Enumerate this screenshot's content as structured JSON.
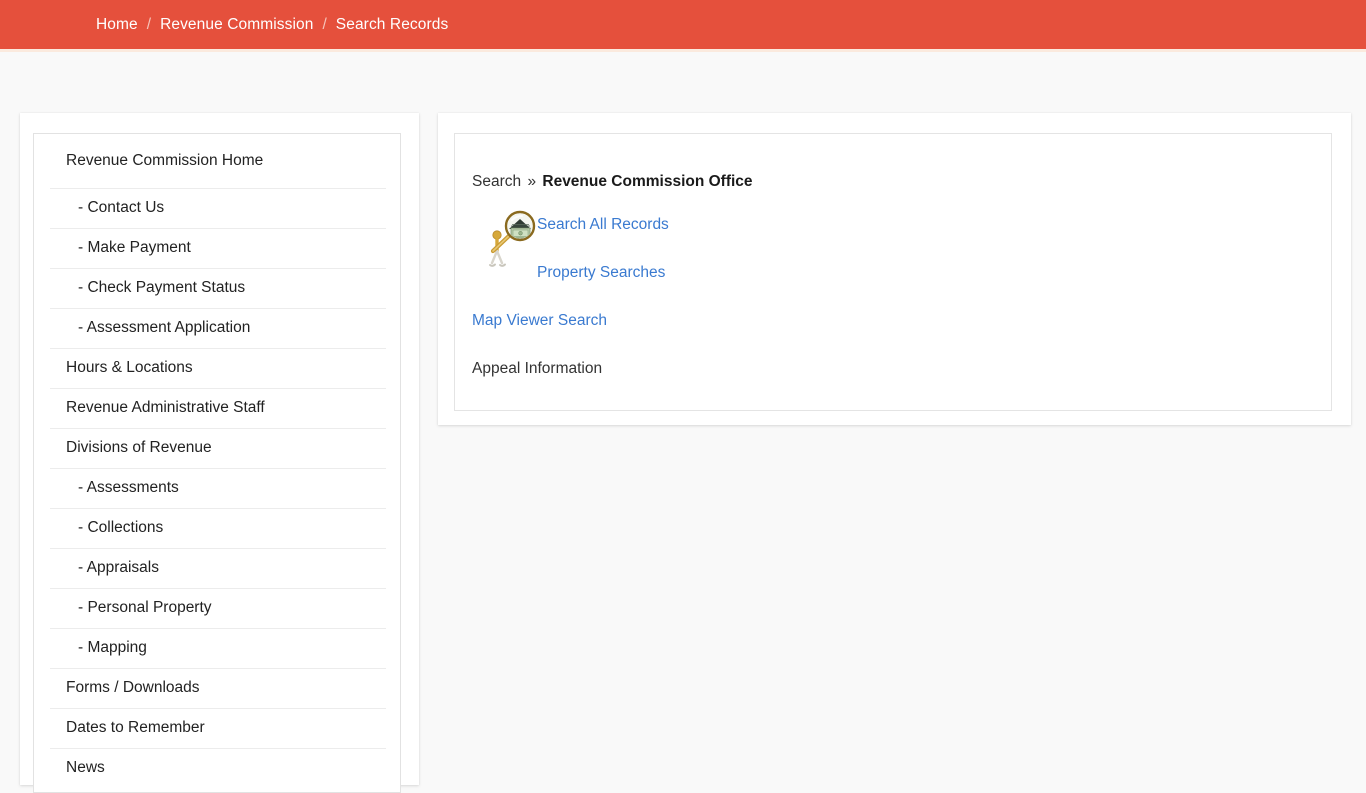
{
  "page": {
    "background_color": "#f9f9f9",
    "title": "Search Records"
  },
  "header": {
    "background_color": "#e5503c",
    "separator": "/",
    "breadcrumbs": [
      {
        "label": "Home"
      },
      {
        "label": "Revenue Commission"
      },
      {
        "label": "Search Records"
      }
    ]
  },
  "sidebar": {
    "items": [
      {
        "label": "Revenue Commission Home",
        "sub": false
      },
      {
        "label": "- Contact Us",
        "sub": true
      },
      {
        "label": "- Make Payment",
        "sub": true
      },
      {
        "label": "- Check Payment Status",
        "sub": true
      },
      {
        "label": "- Assessment Application",
        "sub": true
      },
      {
        "label": "Hours & Locations",
        "sub": false
      },
      {
        "label": "Revenue Administrative Staff",
        "sub": false
      },
      {
        "label": "Divisions of Revenue",
        "sub": false
      },
      {
        "label": "- Assessments",
        "sub": true
      },
      {
        "label": "- Collections",
        "sub": true
      },
      {
        "label": "- Appraisals",
        "sub": true
      },
      {
        "label": "- Personal Property",
        "sub": true
      },
      {
        "label": "- Mapping",
        "sub": true
      },
      {
        "label": "Forms / Downloads",
        "sub": false
      },
      {
        "label": "Dates to Remember",
        "sub": false
      },
      {
        "label": "News",
        "sub": false
      }
    ]
  },
  "main": {
    "heading": {
      "prefix": "Search",
      "chevron": "»",
      "office": "Revenue Commission Office"
    },
    "icon_name": "magnifying-glass-money-clipart",
    "links": [
      {
        "label": "Search All Records",
        "color": "#3a7ad0"
      },
      {
        "label": "Property Searches",
        "color": "#3a7ad0"
      },
      {
        "label": "Map Viewer Search",
        "color": "#3a7ad0"
      }
    ],
    "plain_items": [
      {
        "label": "Appeal Information",
        "color": "#333333"
      }
    ]
  }
}
